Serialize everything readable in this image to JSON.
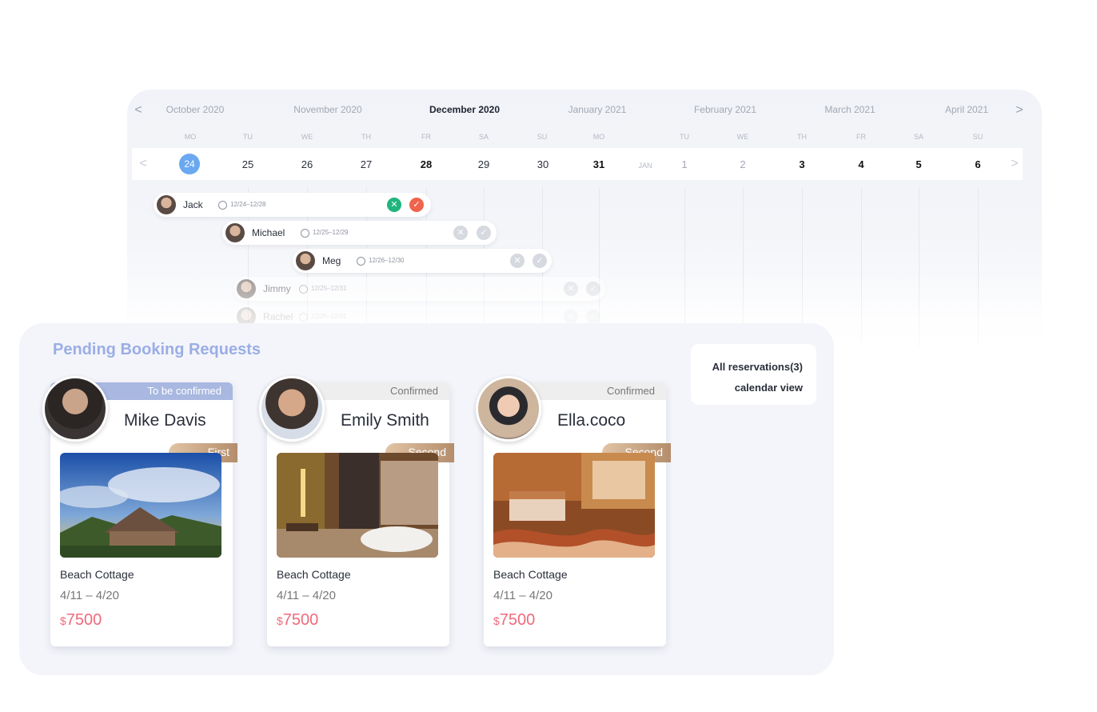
{
  "calendar": {
    "months": [
      "October 2020",
      "November 2020",
      "December 2020",
      "January 2021",
      "February 2021",
      "March 2021",
      "April 2021"
    ],
    "active_month": "December 2020",
    "weekdays": [
      "MO",
      "TU",
      "WE",
      "TH",
      "FR",
      "SA",
      "SU",
      "MO",
      "TU",
      "WE",
      "TH",
      "FR",
      "SA",
      "SU"
    ],
    "dates": [
      "24",
      "25",
      "26",
      "27",
      "28",
      "29",
      "30",
      "31",
      "JAN",
      "1",
      "2",
      "3",
      "4",
      "5",
      "6"
    ],
    "bookings": [
      {
        "name": "Jack",
        "range": "12/24–12/28"
      },
      {
        "name": "Michael",
        "range": "12/25–12/29"
      },
      {
        "name": "Meg",
        "range": "12/26–12/30"
      },
      {
        "name": "Jimmy",
        "range": "12/25–12/31"
      },
      {
        "name": "Rachel",
        "range": "12/25–12/31"
      }
    ],
    "nav_prev": "<",
    "nav_next": ">",
    "accept_icon": "check-icon",
    "decline_icon": "close-icon"
  },
  "pending": {
    "title": "Pending Booking Requests",
    "reservations_link": "All reservations(3)",
    "calendar_link": "calendar view",
    "cards": [
      {
        "status": "To be confirmed",
        "name": "Mike Davis",
        "rank": "First",
        "place": "Beach Cottage",
        "dates": "4/11 – 4/20",
        "currency": "$",
        "price": "7500"
      },
      {
        "status": "Confirmed",
        "name": "Emily Smith",
        "rank": "Second",
        "place": "Beach Cottage",
        "dates": "4/11 – 4/20",
        "currency": "$",
        "price": "7500"
      },
      {
        "status": "Confirmed",
        "name": "Ella.coco",
        "rank": "Second",
        "place": "Beach Cottage",
        "dates": "4/11 – 4/20",
        "currency": "$",
        "price": "7500"
      }
    ]
  },
  "colors": {
    "accent": "#9aaee6",
    "price": "#f06a7b",
    "today": "#6aa8f0",
    "accept": "#1fb57c",
    "decline": "#f0634c"
  }
}
